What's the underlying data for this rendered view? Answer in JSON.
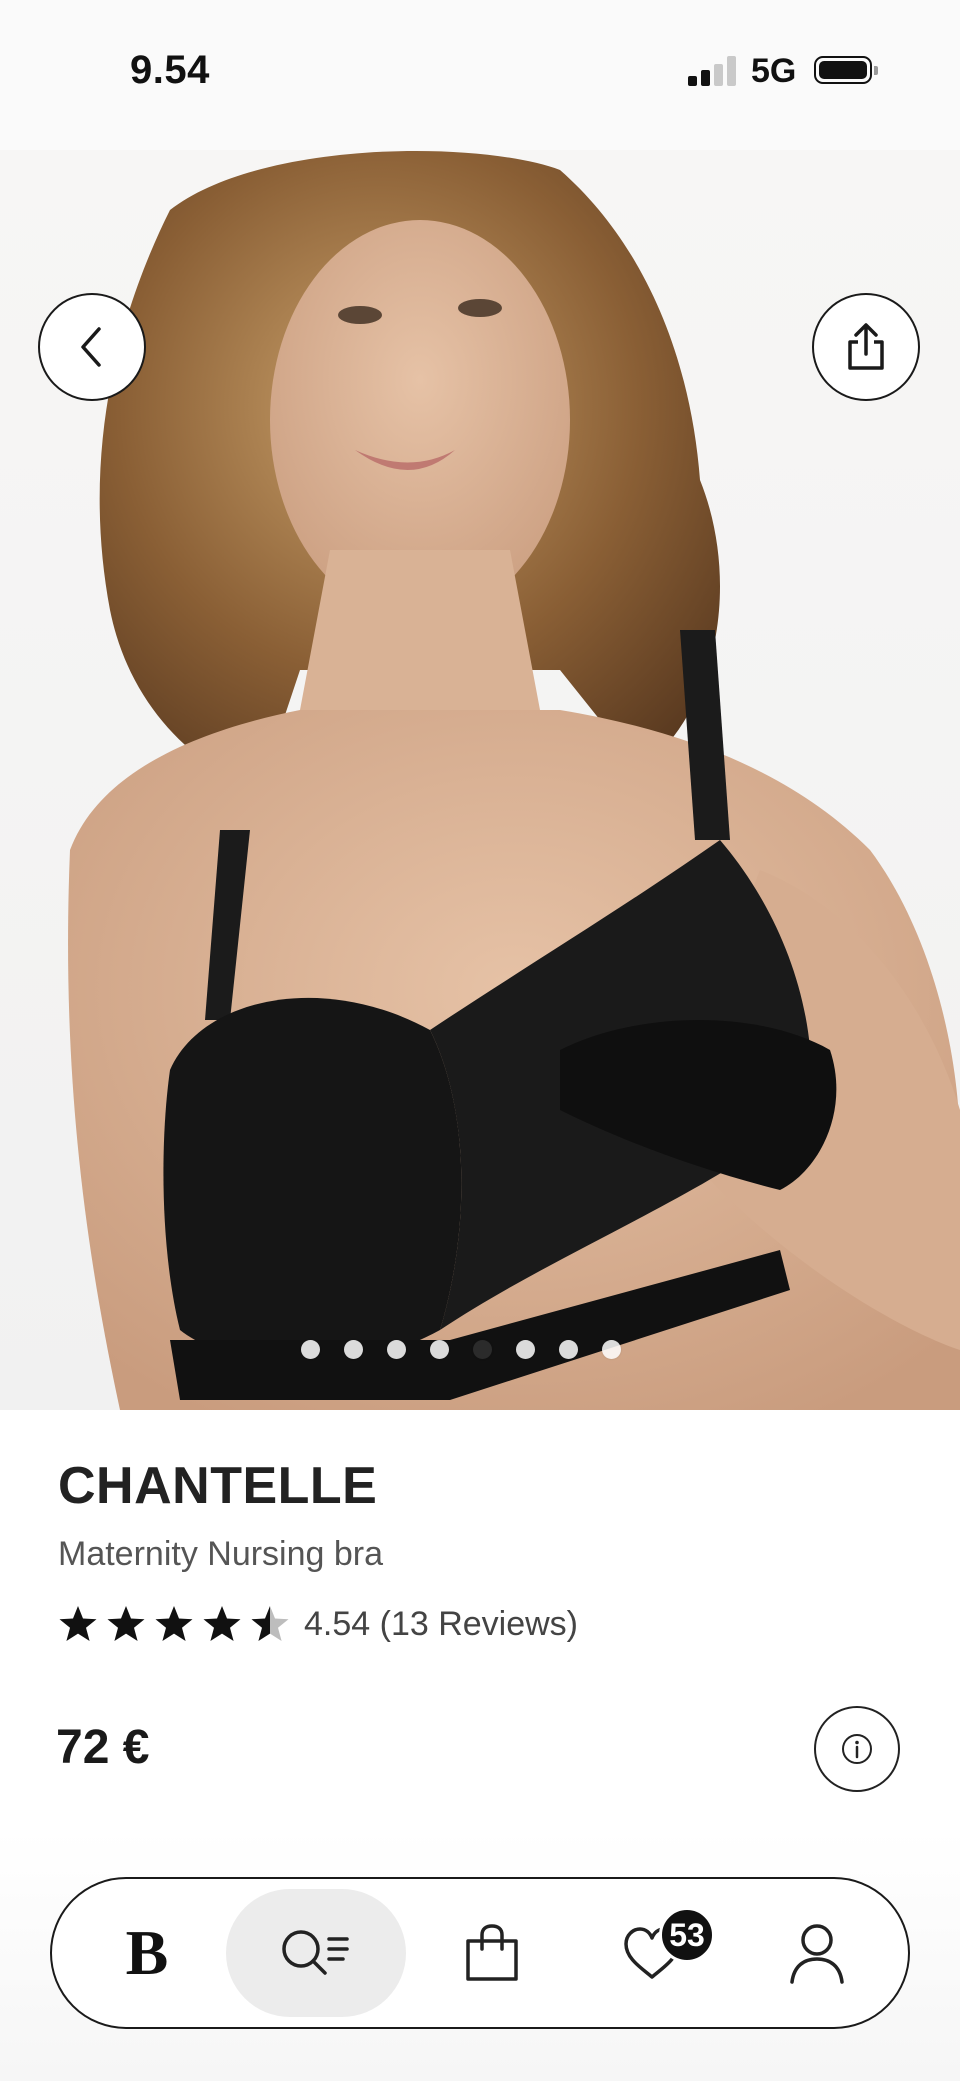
{
  "status_bar": {
    "time": "9.54",
    "network": "5G"
  },
  "product": {
    "brand": "CHANTELLE",
    "name": "Maternity Nursing bra",
    "rating": 4.54,
    "rating_text": "4.54 (13 Reviews)",
    "stars_filled": 4.5,
    "price": "72 €"
  },
  "gallery": {
    "image_count": 8,
    "active_index": 4
  },
  "nav": {
    "brand_glyph": "B",
    "wishlist_badge": "53",
    "active_tab": "search"
  },
  "colors": {
    "text": "#1a1a1a",
    "muted": "#555555",
    "active_pill": "#ececec",
    "badge": "#111111"
  },
  "icons": [
    "back-chevron-icon",
    "share-icon",
    "heart-icon",
    "star-icon",
    "info-icon",
    "search-list-icon",
    "shopping-bag-icon",
    "heart-icon",
    "user-icon"
  ]
}
